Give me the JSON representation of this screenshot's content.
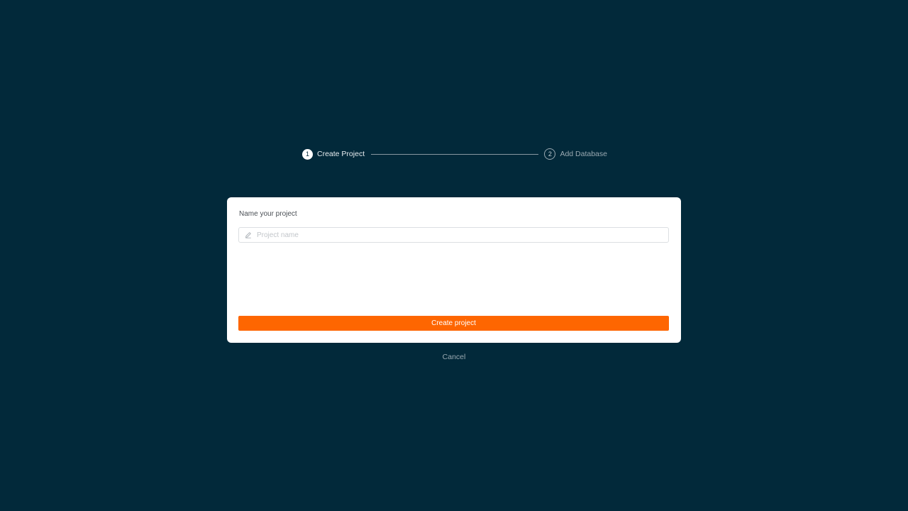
{
  "stepper": {
    "steps": [
      {
        "number": "1",
        "label": "Create Project",
        "state": "active"
      },
      {
        "number": "2",
        "label": "Add Database",
        "state": "inactive"
      }
    ]
  },
  "form": {
    "title": "Name your project",
    "project_name": {
      "value": "",
      "placeholder": "Project name",
      "icon": "pencil-icon"
    },
    "submit_label": "Create project"
  },
  "cancel_label": "Cancel",
  "colors": {
    "background": "#02293a",
    "card": "#ffffff",
    "accent": "#fe6601",
    "muted_text": "#9aa9b1"
  }
}
